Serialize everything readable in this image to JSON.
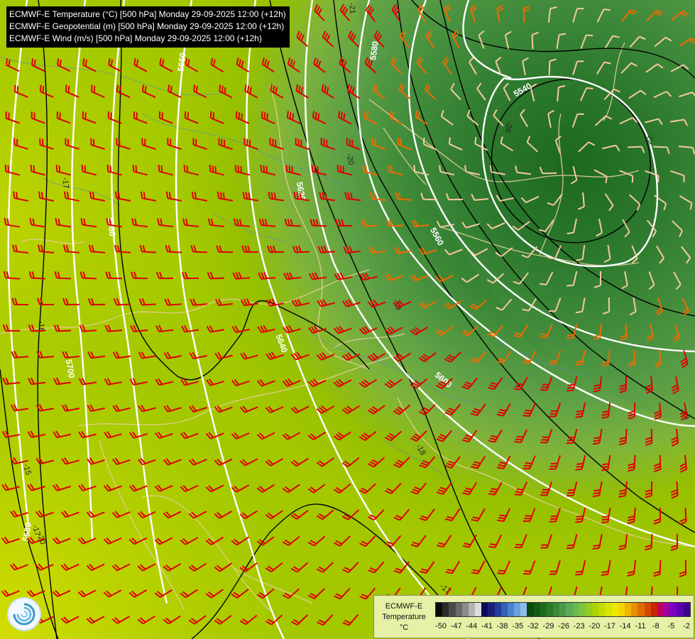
{
  "titles": {
    "temperature": "ECMWF-E Temperature (°C) [500 hPa] Monday 29-09-2025 12:00 (+12h)",
    "geopotential": "ECMWF-E Geopotential (m) [500 hPa] Monday 29-09-2025 12:00 (+12h)",
    "wind": "ECMWF-E Wind (m/s) [500 hPa] Monday 29-09-2025 12:00 (+12h)"
  },
  "legend": {
    "name_line1": "ECMWF-E",
    "name_line2": "Temperature",
    "unit": "°C",
    "ticks": [
      "-50",
      "-47",
      "-44",
      "-41",
      "-38",
      "-35",
      "-32",
      "-29",
      "-26",
      "-23",
      "-20",
      "-17",
      "-14",
      "-11",
      "-8",
      "-5",
      "-2"
    ],
    "colors": [
      "#0a0a0a",
      "#2a2a2a",
      "#4a4a4a",
      "#6a6a6a",
      "#8c8c8c",
      "#b4b4b4",
      "#dcdcdc",
      "#0c0c58",
      "#18207a",
      "#223c9a",
      "#3060b8",
      "#4a82cc",
      "#6aa0dc",
      "#8cbcec",
      "#0a4a0a",
      "#145a14",
      "#1e6a1e",
      "#2a7a2a",
      "#388a38",
      "#489a48",
      "#5aaa5a",
      "#6aba50",
      "#7ec43a",
      "#94cc22",
      "#aad400",
      "#c0dc00",
      "#d8e400",
      "#ece800",
      "#f4d400",
      "#f0b400",
      "#e89000",
      "#e06c00",
      "#d44800",
      "#c82400",
      "#c00060",
      "#a000a0",
      "#7c00c0",
      "#5a00b0",
      "#3c0090"
    ]
  },
  "contour_labels": {
    "geopotential": [
      "5580",
      "5660",
      "5620",
      "5660",
      "5560",
      "5540",
      "5640",
      "5600",
      "5700",
      "5680"
    ],
    "temperature": [
      "-21",
      "-20",
      "-28",
      "-27",
      "-17",
      "-16",
      "-19",
      "-18",
      "-17",
      "-15",
      "-17",
      "-20",
      "-23"
    ]
  },
  "icons": {
    "logo": "ecmwf-logo-icon"
  }
}
